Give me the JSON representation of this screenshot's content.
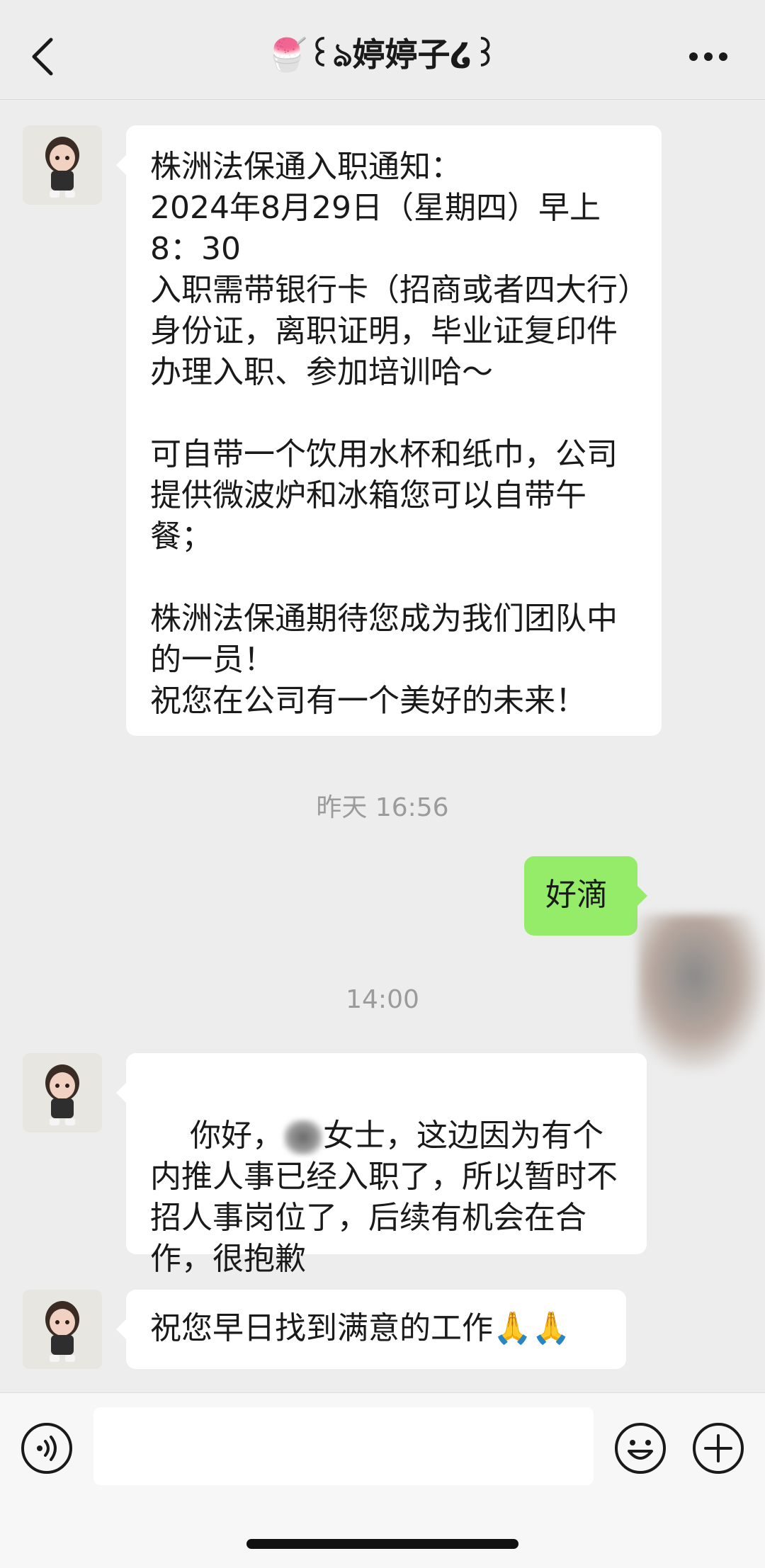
{
  "header": {
    "title": "🍧꒰ঌ婷婷子໒꒱"
  },
  "messages": [
    {
      "sender": "contact",
      "text": "株洲法保通入职通知：\n2024年8月29日（星期四）早上8：30\n入职需带银行卡（招商或者四大行）身份证，离职证明，毕业证复印件办理入职、参加培训哈～\n\n可自带一个饮用水杯和纸巾，公司提供微波炉和冰箱您可以自带午餐；\n\n株洲法保通期待您成为我们团队中的一员！\n祝您在公司有一个美好的未来！"
    },
    {
      "sender": "me",
      "text": "好滴"
    },
    {
      "sender": "contact",
      "text_before": "你好，",
      "text_after": "女士，这边因为有个内推人事已经入职了，所以暂时不招人事岗位了，后续有机会在合作，很抱歉"
    },
    {
      "sender": "contact",
      "text": "祝您早日找到满意的工作🙏🙏"
    }
  ],
  "timestamps": {
    "t1": "昨天 16:56",
    "t2": "14:00"
  },
  "input": {
    "value": ""
  },
  "icons": {
    "back": "chevron-left-icon",
    "more": "more-dots-icon",
    "voice": "voice-icon",
    "emoji": "emoji-icon",
    "plus": "plus-icon"
  },
  "colors": {
    "background": "#ededed",
    "outgoing_bubble": "#95ec69",
    "incoming_bubble": "#ffffff"
  }
}
